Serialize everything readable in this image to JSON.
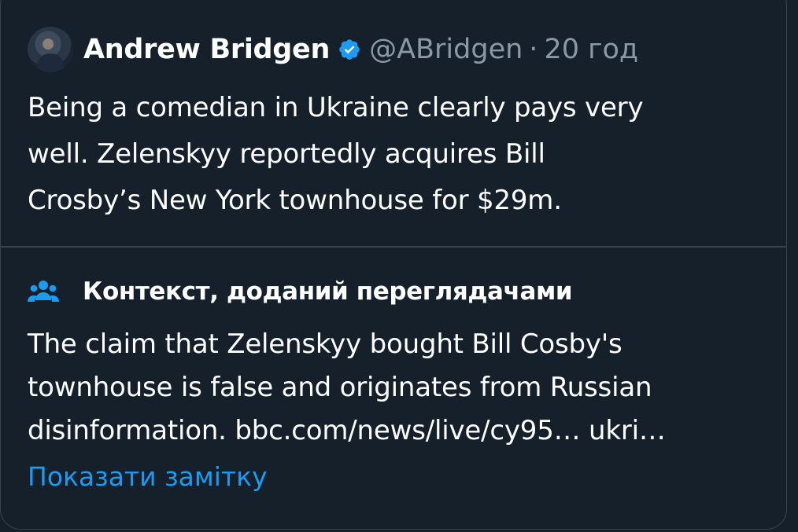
{
  "post": {
    "author_name": "Andrew Bridgen",
    "handle": "@ABridgen",
    "separator": "·",
    "time": "20 год",
    "text_lines": [
      "Being a comedian in Ukraine clearly pays very",
      "well. Zelenskyy reportedly acquires Bill",
      "Crosby’s New York townhouse for $29m."
    ]
  },
  "community_note": {
    "title": "Контекст, доданий переглядачами",
    "text_lines": [
      "The claim that Zelenskyy bought Bill Cosby's",
      "townhouse is false and originates from Russian",
      "disinformation. bbc.com/news/live/cy95… ukri…"
    ],
    "show_note_label": "Показати замітку"
  },
  "colors": {
    "background": "#15202b",
    "border": "#38444d",
    "primary_text": "#ffffff",
    "secondary_text": "#8b98a5",
    "link": "#1d9bf0",
    "verified_badge": "#1d9bf0"
  },
  "icons": {
    "verified": "verified-badge-icon",
    "note": "people-icon"
  }
}
